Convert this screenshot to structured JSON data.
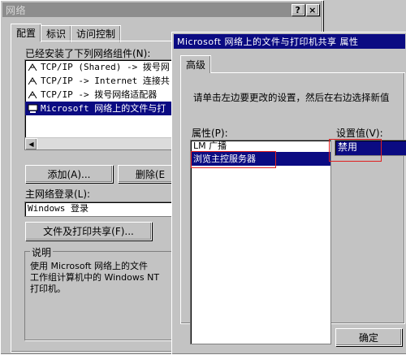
{
  "network_dialog": {
    "title": "网络",
    "help_button": "?",
    "close_button": "×",
    "tabs": [
      "配置",
      "标识",
      "访问控制"
    ],
    "components_label": "已经安装了下列网络组件(N):",
    "components": [
      "TCP/IP (Shared) -> 拨号网",
      "TCP/IP -> Internet 连接共",
      "TCP/IP -> 拨号网络适配器",
      "Microsoft 网络上的文件与打"
    ],
    "add_button": "添加(A)...",
    "remove_button": "删除(E",
    "primary_logon_label": "主网络登录(L):",
    "primary_logon_value": "Windows 登录",
    "file_print_button": "文件及打印共享(F)...",
    "description_title": "说明",
    "description_text": "使用 Microsoft 网络上的文件与打印机共享，以便与工作组计算机中的 Windows NT 或 Windows 打印机。",
    "description_lines": [
      "使用 Microsoft 网络上的文件",
      "工作组计算机中的 Windows NT",
      "打印机。"
    ]
  },
  "props_dialog": {
    "title": "Microsoft 网络上的文件与打印机共享 属性",
    "tabs": [
      "高级"
    ],
    "instruction": "请单击左边要更改的设置，然后在右边选择新值",
    "property_label": "属性(P):",
    "properties": [
      "LM 广播",
      "浏览主控服务器"
    ],
    "selected_property_index": 1,
    "value_label": "设置值(V):",
    "value": "禁用",
    "ok_button": "确定"
  },
  "colors": {
    "selection": "#0b0b82",
    "highlight_box": "#e02020",
    "face": "#c3c3c3"
  }
}
